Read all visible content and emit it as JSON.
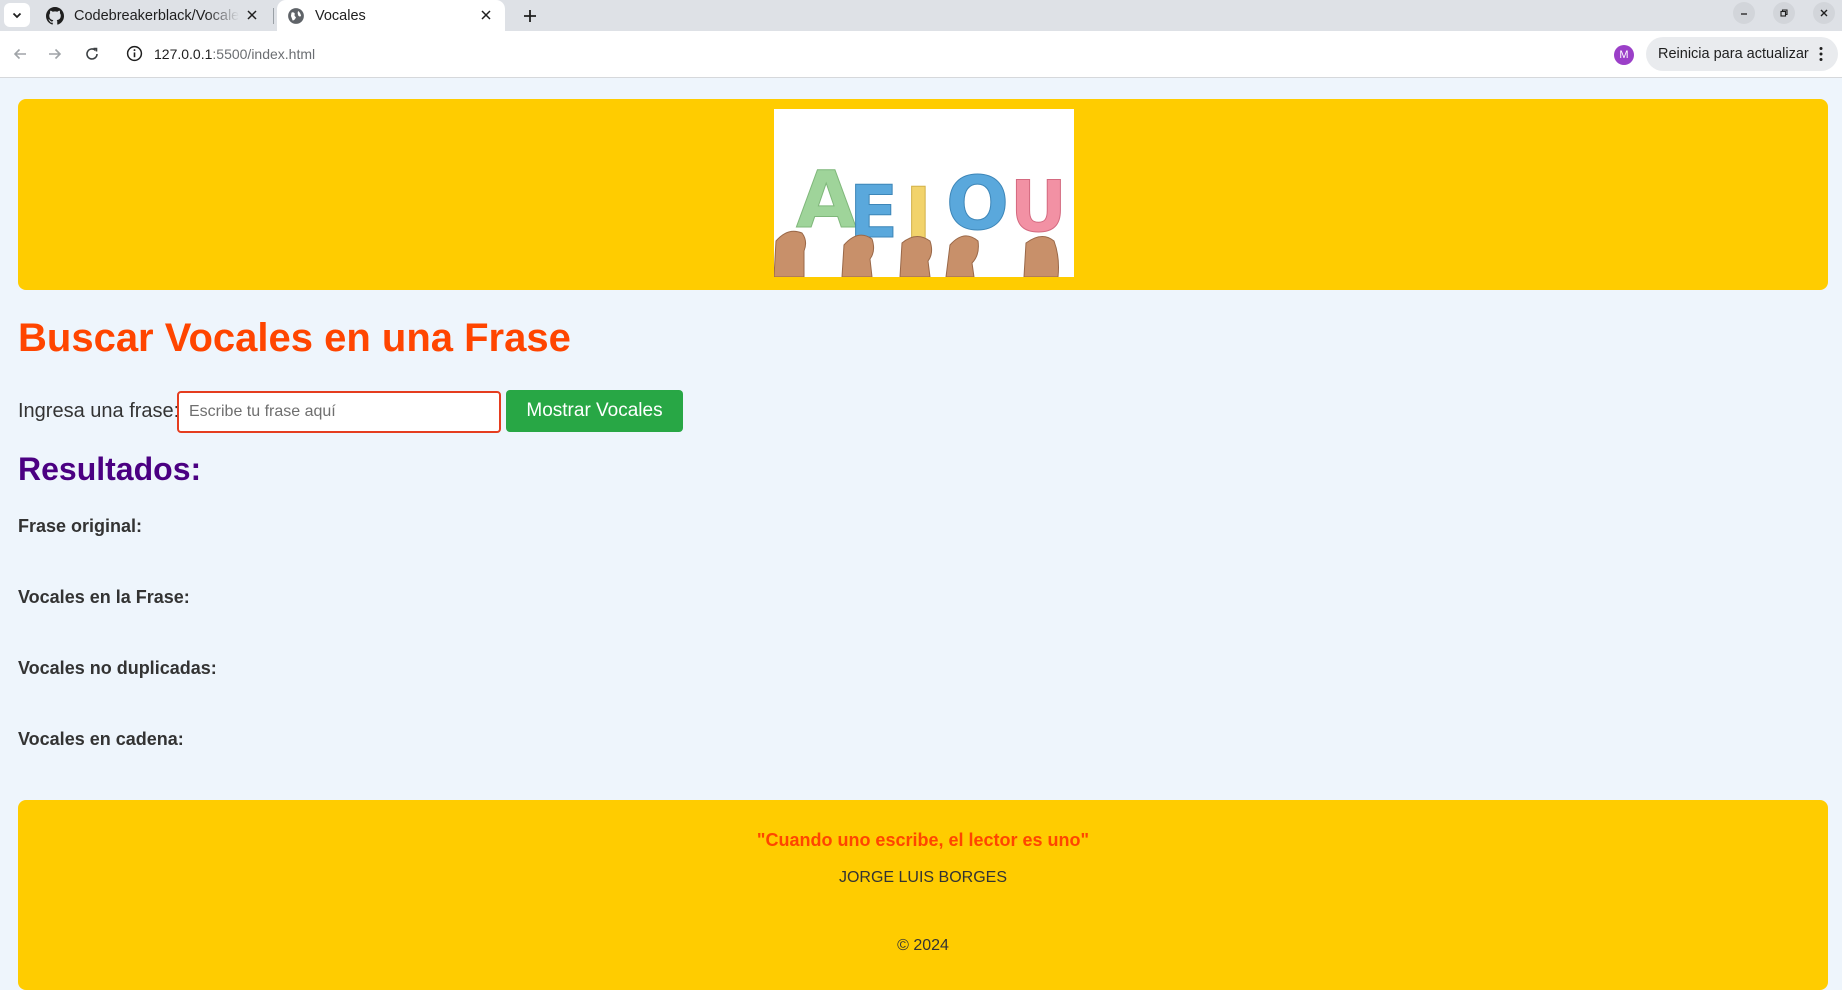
{
  "browser": {
    "tabs": [
      {
        "title": "Codebreakerblack/Vocales",
        "icon": "github-icon",
        "active": false
      },
      {
        "title": "Vocales",
        "icon": "globe-icon",
        "active": true
      }
    ],
    "url_host": "127.0.0.1",
    "url_path": ":5500/index.html",
    "profile_initial": "M",
    "update_label": "Reinicia para actualizar"
  },
  "header": {
    "image_letters": [
      "A",
      "E",
      "I",
      "O",
      "U"
    ],
    "letter_colors": [
      "#9fd49a",
      "#5aa8dc",
      "#f2d36b",
      "#5aa8dc",
      "#f291a4"
    ]
  },
  "main": {
    "title": "Buscar Vocales en una Frase",
    "input_label": "Ingresa una frase:",
    "input_placeholder": "Escribe tu frase aquí",
    "input_value": "",
    "button_label": "Mostrar Vocales"
  },
  "results": {
    "title": "Resultados:",
    "labels": [
      "Frase original:",
      "Vocales en la Frase:",
      "Vocales no duplicadas:",
      "Vocales en cadena:"
    ]
  },
  "footer": {
    "quote": "\"Cuando uno escribe, el lector es uno\"",
    "author": "JORGE LUIS BORGES",
    "copyright": "© 2024"
  },
  "colors": {
    "banner": "#ffcc00",
    "title": "#ff4500",
    "results_title": "#4b0082",
    "button": "#28a745",
    "page_bg": "#eef5fc"
  }
}
